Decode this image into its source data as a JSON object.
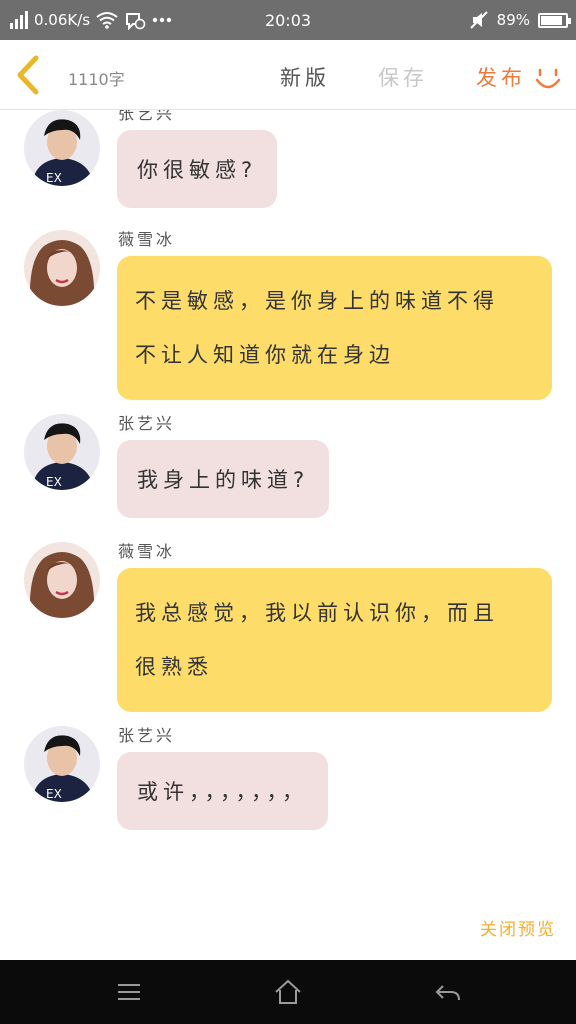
{
  "status_bar": {
    "speed": "0.06K/s",
    "time": "20:03",
    "battery": "89%",
    "battery_level": 0.89,
    "icons": [
      "signal-icon",
      "wifi-icon",
      "notification-icon",
      "more-dots-icon",
      "mute-icon",
      "battery-icon"
    ]
  },
  "toolbar": {
    "word_count": "1110字",
    "new_label": "新版",
    "save_label": "保存",
    "publish_label": "发布",
    "icons": [
      "back-chevron-icon",
      "smile-icon"
    ],
    "colors": {
      "publish": "#ef7a3c",
      "save_disabled": "#c8c8c8",
      "back": "#e8b82a"
    }
  },
  "messages": [
    {
      "sender": "张艺兴",
      "text": "你很敏感?",
      "style": "pink"
    },
    {
      "sender": "薇雪冰",
      "lines": [
        "不是敏感，是你身上的味道不得",
        "不让人知道你就在身边"
      ],
      "style": "yellow"
    },
    {
      "sender": "张艺兴",
      "text": "我身上的味道?",
      "style": "pink"
    },
    {
      "sender": "薇雪冰",
      "lines": [
        "我总感觉，我以前认识你，而且",
        "很熟悉"
      ],
      "style": "yellow"
    },
    {
      "sender": "张艺兴",
      "text": "或许，，，，，，，",
      "style": "pink"
    }
  ],
  "bubble_colors": {
    "pink": "#f2dfdf",
    "yellow": "#fedc6a"
  },
  "close_preview": "关闭预览",
  "nav_bar": {
    "icons": [
      "menu-icon",
      "home-icon",
      "back-arrow-icon"
    ]
  }
}
